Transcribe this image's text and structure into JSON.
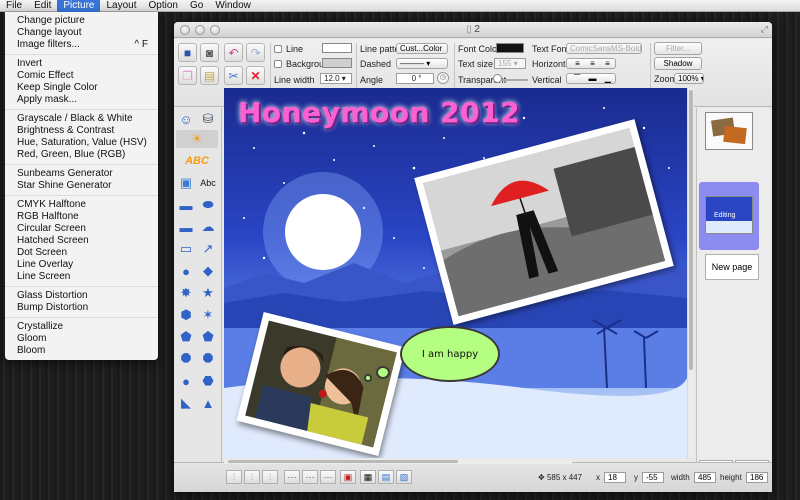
{
  "menubar": {
    "items": [
      "File",
      "Edit",
      "Picture",
      "Layout",
      "Option",
      "Go",
      "Window"
    ],
    "active": "Picture"
  },
  "picture_menu": {
    "groups": [
      [
        {
          "label": "Change picture"
        },
        {
          "label": "Change layout"
        },
        {
          "label": "Image filters...",
          "shortcut": "^ F"
        }
      ],
      [
        {
          "label": "Invert"
        },
        {
          "label": "Comic Effect"
        },
        {
          "label": "Keep Single Color"
        },
        {
          "label": "Apply mask..."
        }
      ],
      [
        {
          "label": "Grayscale / Black & White"
        },
        {
          "label": "Brightness & Contrast"
        },
        {
          "label": "Hue, Saturation, Value (HSV)"
        },
        {
          "label": "Red, Green, Blue (RGB)"
        }
      ],
      [
        {
          "label": "Sunbeams Generator"
        },
        {
          "label": "Star Shine Generator"
        }
      ],
      [
        {
          "label": "CMYK Halftone"
        },
        {
          "label": "RGB Halftone"
        },
        {
          "label": "Circular Screen"
        },
        {
          "label": "Hatched Screen"
        },
        {
          "label": "Dot Screen"
        },
        {
          "label": "Line Overlay"
        },
        {
          "label": "Line Screen"
        }
      ],
      [
        {
          "label": "Glass Distortion"
        },
        {
          "label": "Bump Distortion"
        }
      ],
      [
        {
          "label": "Crystallize"
        },
        {
          "label": "Gloom"
        },
        {
          "label": "Bloom"
        }
      ]
    ]
  },
  "window": {
    "title": "2"
  },
  "toolbar": {
    "line_label": "Line",
    "background_label": "Background",
    "line_width_label": "Line width",
    "line_width_value": "12.0",
    "line_pattern_label": "Line pattern",
    "line_pattern_value": "Cust...Color",
    "dashed_label": "Dashed",
    "angle_label": "Angle",
    "angle_value": "0 °",
    "font_color_label": "Font Color",
    "font_color": "#111111",
    "text_size_label": "Text size",
    "text_size_value": "155",
    "transparent_label": "Transparent",
    "text_font_label": "Text Font",
    "text_font_value": "ComicSansMS-Bold",
    "horizontal_label": "Horizontal",
    "vertical_label": "Vertical",
    "filter_label": "Filter...",
    "shadow_label": "Shadow",
    "zoom_label": "Zoom",
    "zoom_value": "100%"
  },
  "palette": {
    "abc_label": "Abc"
  },
  "canvas": {
    "heading": "Honeymoon 2012",
    "bubble_text": "I am happy"
  },
  "pages": {
    "editing_label": "Editing",
    "new_page_label": "New page",
    "add_label": "+",
    "remove_label": "×"
  },
  "status": {
    "size": "585 x 447",
    "x_label": "x",
    "x_value": "18",
    "y_label": "y",
    "y_value": "-55",
    "width_label": "width",
    "width_value": "485",
    "height_label": "height",
    "height_value": "186"
  },
  "colors": {
    "menu_accent": "#3875d7",
    "heading": "#ff5fd0",
    "bubble": "#b4ff82",
    "editing_thumb_bg": "#8c8cf0"
  }
}
